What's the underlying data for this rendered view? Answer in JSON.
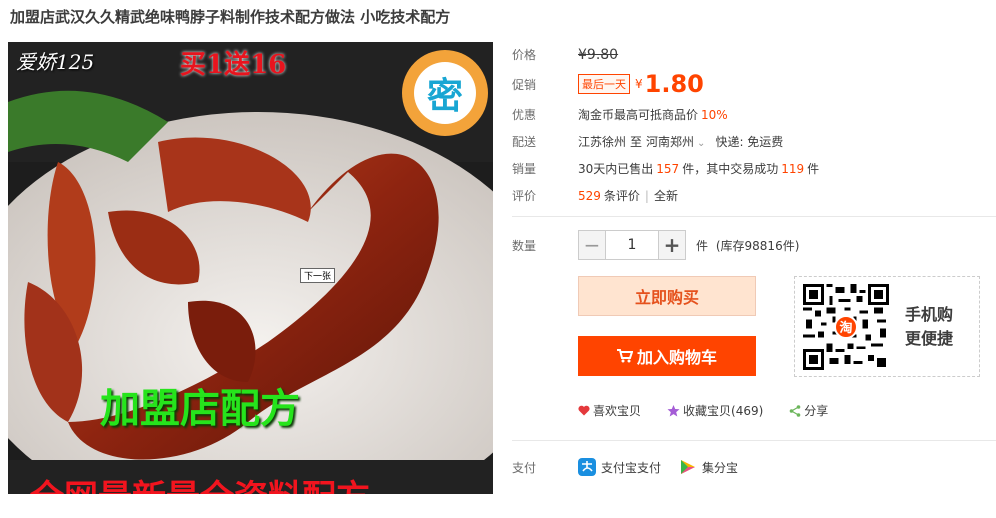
{
  "title": "加盟店武汉久久精武绝味鸭脖子料制作技术配方做法 小吃技术配方",
  "image": {
    "watermark_user": "爱娇125",
    "promo": "买1送16",
    "badge_char": "密",
    "next_label": "下一张",
    "overlay_title": "加盟店配方",
    "bottom_banner": "全网最新最全资料配方"
  },
  "price": {
    "label": "价格",
    "original_currency": "¥",
    "original": "9.80"
  },
  "promo_price": {
    "label": "促销",
    "tag": "最后一天",
    "currency": "¥",
    "value": "1.80"
  },
  "discount": {
    "label": "优惠",
    "text": "淘金币最高可抵商品价",
    "percent": "10%"
  },
  "shipping": {
    "label": "配送",
    "from": "江苏徐州",
    "to_word": "至",
    "to": "河南郑州",
    "express": "快递: 免运费"
  },
  "sales": {
    "label": "销量",
    "prefix": "30天内已售出",
    "sold": "157",
    "mid": "件，其中交易成功",
    "success": "119",
    "suffix": "件"
  },
  "reviews": {
    "label": "评价",
    "count": "529",
    "count_suffix": "条评价",
    "new_label": "全新"
  },
  "quantity": {
    "label": "数量",
    "value": "1",
    "unit": "件",
    "stock": "(库存98816件)"
  },
  "buttons": {
    "buy_now": "立即购买",
    "add_cart": "加入购物车"
  },
  "mobile": {
    "line1": "手机购",
    "line2": "更便捷",
    "qr_logo": "淘"
  },
  "actions": {
    "like": "喜欢宝贝",
    "favorite": "收藏宝贝(469)",
    "share": "分享"
  },
  "payment": {
    "label": "支付",
    "alipay": "支付宝支付",
    "jifenbao": "集分宝"
  },
  "colors": {
    "accent": "#ff4400",
    "buy_bg": "#ffe4d0",
    "like_heart": "#e4393c",
    "favorite_star": "#a45cd6",
    "share": "#6bb55a"
  },
  "icons": [
    "minus-icon",
    "plus-icon",
    "cart-icon",
    "qr-code-icon",
    "heart-icon",
    "star-icon",
    "share-icon",
    "alipay-icon",
    "jifenbao-icon",
    "chevron-down-icon"
  ]
}
